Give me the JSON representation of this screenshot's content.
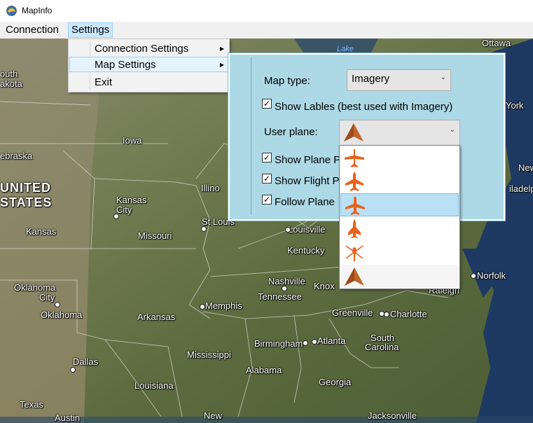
{
  "window": {
    "title": "MapInfo"
  },
  "menubar": {
    "items": [
      "Connection",
      "Settings"
    ]
  },
  "settings_menu": {
    "items": [
      {
        "label": "Connection Settings",
        "submenu": true
      },
      {
        "label": "Map Settings",
        "submenu": true
      },
      {
        "label": "Exit",
        "submenu": false
      }
    ]
  },
  "map_settings": {
    "map_type_label": "Map type:",
    "map_type_value": "Imagery",
    "show_labels_label": "Show Lables (best used with Imagery)",
    "show_labels_checked": true,
    "user_plane_label": "User plane:",
    "show_plane_label": "Show Plane P",
    "show_plane_checked": true,
    "show_flight_label": "Show Flight P",
    "show_flight_checked": true,
    "follow_plane_label": "Follow Plane",
    "follow_plane_checked": true
  },
  "plane_options": {
    "icons": [
      "plane-icon",
      "jet-icon",
      "airliner-icon",
      "fighter-jet-icon",
      "helicopter-icon",
      "arrow-marker-icon"
    ],
    "selected_index": 2,
    "current": "arrow-marker-icon",
    "color_plane": "#e8621a",
    "color_arrow": "#c0652a"
  },
  "map_labels": {
    "lake": "Lake",
    "ottawa": "Ottawa",
    "south_dakota_1": "outh",
    "south_dakota_2": "akota",
    "york": "York",
    "nebraska": "ebraska",
    "iowa": "Iowa",
    "new": "New",
    "united": "UNITED",
    "states": "STATES",
    "illinois": "Illino",
    "kansas_city_1": "Kansas",
    "kansas_city_2": "City",
    "philadelphia": "iladelpl",
    "kansas": "Kansas",
    "missouri": "Missouri",
    "st_louis": "St Louis",
    "louisville": "Louisville",
    "kentucky": "Kentucky",
    "norfolk": "Norfolk",
    "nashville": "Nashville",
    "knoxville": "Knox",
    "raleigh": "Raleigh",
    "oklahoma_city_1": "Oklahoma",
    "oklahoma_city_2": "City",
    "tennessee": "Tennessee",
    "memphis": "Memphis",
    "oklahoma": "Oklahoma",
    "greenville": "Greenville",
    "charlotte": "Charlotte",
    "arkansas": "Arkansas",
    "south_carolina_1": "South",
    "south_carolina_2": "Carolina",
    "birmingham": "Birmingham",
    "atlanta": "Atlanta",
    "mississippi": "Mississippi",
    "dallas": "Dallas",
    "alabama": "Alabama",
    "georgia": "Georgia",
    "louisiana": "Louisiana",
    "texas": "Texas",
    "austin": "Austin",
    "new_orleans": "New",
    "jacksonville": "Jacksonville"
  }
}
